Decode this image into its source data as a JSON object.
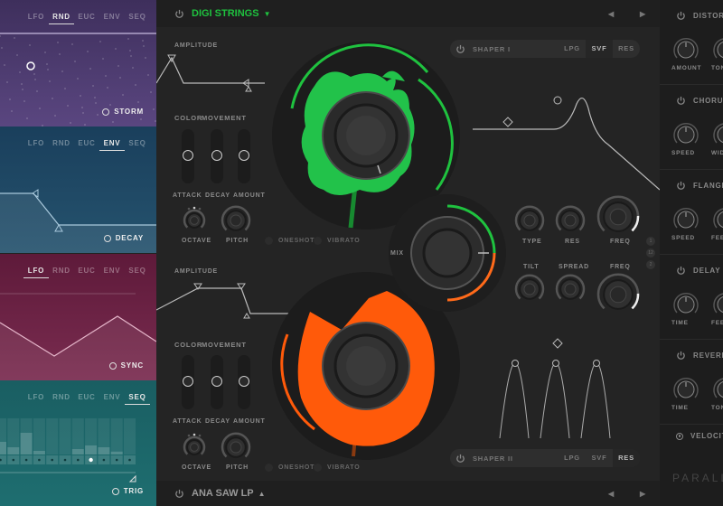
{
  "colors": {
    "osc1": "#1fc23f",
    "osc2": "#ff5a0a",
    "purple": "#4a3768",
    "blue": "#1d4a66",
    "maroon": "#6a1f40",
    "teal": "#1c6a6c"
  },
  "mod_tabs": [
    "LFO",
    "RND",
    "EUC",
    "ENV",
    "SEQ"
  ],
  "mod_panels": [
    {
      "active": "RND",
      "button": "STORM"
    },
    {
      "active": "ENV",
      "button": "DECAY"
    },
    {
      "active": "LFO",
      "button": "SYNC"
    },
    {
      "active": "SEQ",
      "button": "TRIG"
    }
  ],
  "seq": {
    "steps": [
      0.35,
      0.2,
      0.6,
      0.1,
      0,
      0,
      0.15,
      0.25,
      0.2,
      0.08,
      0
    ],
    "active_step": 7
  },
  "osc1": {
    "name": "DIGI STRINGS",
    "amplitude": "AMPLITUDE",
    "color": "COLOR",
    "movement": "MOVEMENT",
    "sliders": [
      "ATTACK",
      "DECAY",
      "AMOUNT"
    ],
    "octave": "OCTAVE",
    "pitch": "PITCH",
    "oneshot": "ONESHOT",
    "vibrato": "VIBRATO"
  },
  "osc2": {
    "name": "ANA SAW LP",
    "amplitude": "AMPLITUDE",
    "color": "COLOR",
    "movement": "MOVEMENT",
    "sliders": [
      "ATTACK",
      "DECAY",
      "AMOUNT"
    ],
    "octave": "OCTAVE",
    "pitch": "PITCH",
    "oneshot": "ONESHOT",
    "vibrato": "VIBRATO"
  },
  "shaper1": {
    "name": "SHAPER I",
    "options": [
      "LPG",
      "SVF",
      "RES"
    ],
    "selected": "SVF"
  },
  "shaper2": {
    "name": "SHAPER II",
    "options": [
      "LPG",
      "SVF",
      "RES"
    ],
    "selected": "RES"
  },
  "mix": "MIX",
  "filter_knobs": {
    "row1": [
      "TYPE",
      "RES",
      "FREQ"
    ],
    "row2": [
      "TILT",
      "SPREAD",
      "FREQ"
    ]
  },
  "route_buttons": [
    "1",
    "12",
    "2"
  ],
  "fx": [
    {
      "name": "DISTORTION",
      "knobs": [
        "AMOUNT",
        "TONE"
      ]
    },
    {
      "name": "CHORUS",
      "knobs": [
        "SPEED",
        "WIDTH"
      ]
    },
    {
      "name": "FLANGER",
      "knobs": [
        "SPEED",
        "FEEDBACK"
      ]
    },
    {
      "name": "DELAY",
      "knobs": [
        "TIME",
        "FEEDBACK"
      ]
    },
    {
      "name": "REVERB",
      "knobs": [
        "TIME",
        "TONE"
      ]
    }
  ],
  "velocity": "VELOCITY",
  "brand": "PARALLAX"
}
